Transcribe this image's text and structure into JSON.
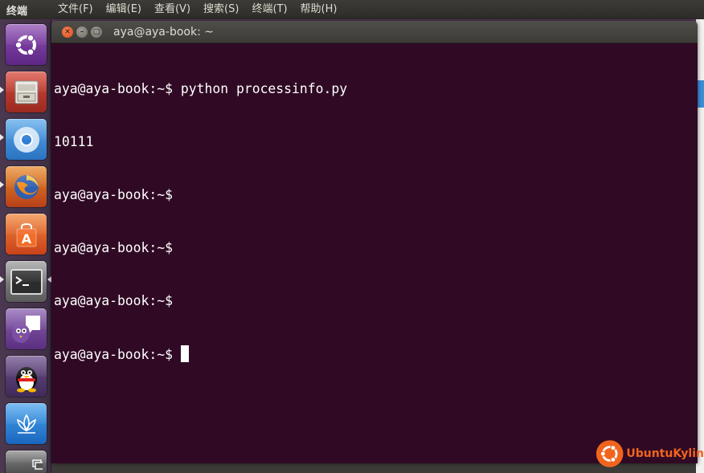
{
  "top_panel": {
    "app_name": "终端",
    "menus": [
      "文件(F)",
      "编辑(E)",
      "查看(V)",
      "搜索(S)",
      "终端(T)",
      "帮助(H)"
    ]
  },
  "launcher": {
    "items": [
      {
        "name": "dash-home",
        "icon": "ubuntu-logo-icon",
        "color": "#7b3aa0"
      },
      {
        "name": "files",
        "icon": "file-cabinet-icon",
        "color": "#b4372a"
      },
      {
        "name": "chromium",
        "icon": "chromium-icon",
        "color": "#3a8fd6"
      },
      {
        "name": "firefox",
        "icon": "firefox-icon",
        "color": "#e66000"
      },
      {
        "name": "software-center",
        "icon": "shopping-bag-icon",
        "color": "#e2531a"
      },
      {
        "name": "terminal",
        "icon": "terminal-icon",
        "color": "#404040"
      },
      {
        "name": "pidgin",
        "icon": "pidgin-icon",
        "color": "#6a3d8f"
      },
      {
        "name": "qq",
        "icon": "penguin-icon",
        "color": "#5a3a7a"
      },
      {
        "name": "kylin-lotus",
        "icon": "lotus-icon",
        "color": "#2b85d8"
      },
      {
        "name": "workspace-switcher",
        "icon": "workspace-icon",
        "color": "#555555"
      }
    ]
  },
  "window": {
    "title": "aya@aya-book: ~"
  },
  "terminal": {
    "lines": [
      "aya@aya-book:~$ python processinfo.py",
      "10111",
      "aya@aya-book:~$",
      "aya@aya-book:~$",
      "aya@aya-book:~$",
      "aya@aya-book:~$ "
    ]
  },
  "watermark": {
    "text": "UbuntuKylin",
    "color": "#f1641e"
  }
}
